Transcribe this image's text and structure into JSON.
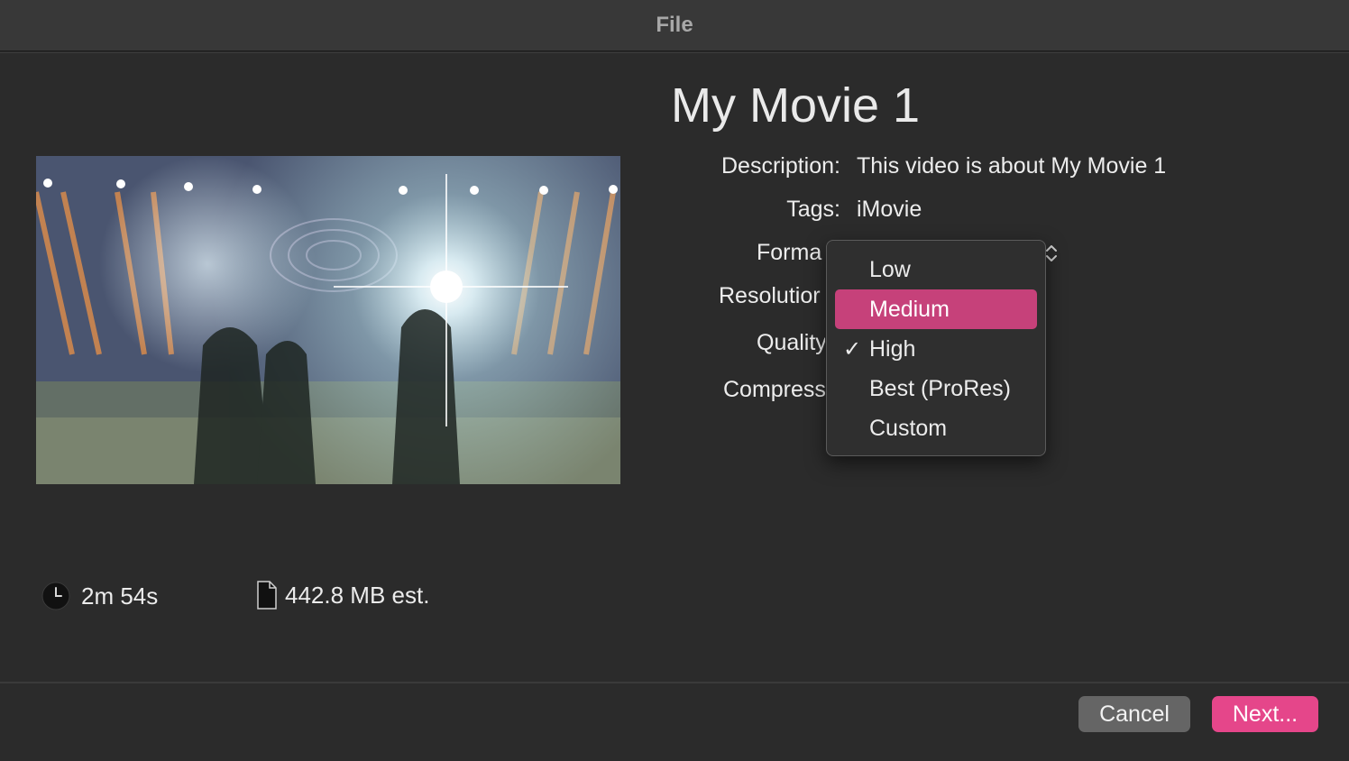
{
  "window": {
    "title": "File"
  },
  "preview": {
    "image": "concert stage with bright lights"
  },
  "stats": {
    "duration": "2m 54s",
    "size": "442.8 MB est."
  },
  "movie": {
    "title": "My Movie 1",
    "description_label": "Description:",
    "description_value": "This video is about My Movie 1",
    "tags_label": "Tags:",
    "tags_value": "iMovie",
    "format_label": "Forma",
    "resolution_label": "Resolutior",
    "quality_label": "Quality",
    "compress_label": "Compress"
  },
  "quality_menu": {
    "items": [
      {
        "label": "Low",
        "checked": false,
        "highlighted": false
      },
      {
        "label": "Medium",
        "checked": false,
        "highlighted": true
      },
      {
        "label": "High",
        "checked": true,
        "highlighted": false
      },
      {
        "label": "Best (ProRes)",
        "checked": false,
        "highlighted": false
      },
      {
        "label": "Custom",
        "checked": false,
        "highlighted": false
      }
    ],
    "check_glyph": "✓"
  },
  "buttons": {
    "cancel": "Cancel",
    "next": "Next..."
  },
  "colors": {
    "accent": "#e5468a",
    "highlight": "#c6417a",
    "background": "#2b2b2b"
  }
}
